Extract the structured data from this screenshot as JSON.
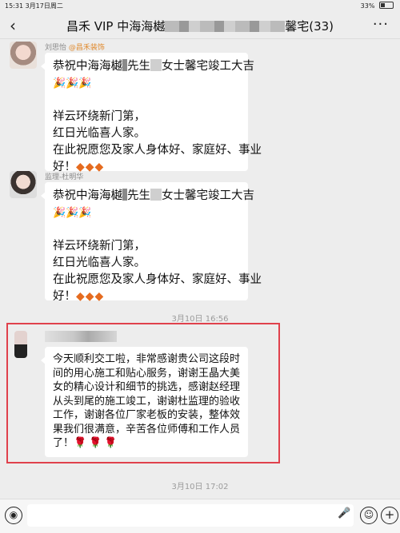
{
  "status": {
    "time_date": "15:31  3月17日周二",
    "battery": "33%",
    "battery_level": 0.33
  },
  "header": {
    "back_icon": "chevron-left-icon",
    "title_prefix": "昌禾 VIP 中海海樾",
    "title_suffix": "馨宅(33)",
    "more_icon": "more-dots-icon"
  },
  "messages": [
    {
      "sender": "刘思怡",
      "tag": "@昌禾装饰",
      "lines": [
        {
          "a": "恭祝中海海樾",
          "b": "先生",
          "c": "女士馨宅竣工大吉"
        },
        {
          "text": "🎉🎉🎉"
        },
        {
          "text": ""
        },
        {
          "text": "祥云环绕新门第，"
        },
        {
          "text": "红日光临喜人家。"
        },
        {
          "text": "在此祝愿您及家人身体好、家庭好、事业"
        },
        {
          "text": "好！",
          "diamonds": "◆◆◆"
        }
      ]
    },
    {
      "sender": "监理-杜明华",
      "lines": [
        {
          "a": "恭祝中海海樾",
          "b": "先生",
          "c": "女士馨宅竣工大吉"
        },
        {
          "text": "🎉🎉🎉"
        },
        {
          "text": ""
        },
        {
          "text": "祥云环绕新门第，"
        },
        {
          "text": "红日光临喜人家。"
        },
        {
          "text": "在此祝愿您及家人身体好、家庭好、事业"
        },
        {
          "text": "好！",
          "diamonds": "◆◆◆"
        }
      ]
    },
    {
      "timestamp": "3月10日 16:56",
      "lines": [
        "今天顺利交工啦，非常感谢贵公司这段时",
        "间的用心施工和贴心服务，谢谢王晶大美",
        "女的精心设计和细节的挑选，感谢赵经理",
        "从头到尾的施工竣工，谢谢杜监理的验收",
        "工作，谢谢各位厂家老板的安装，整体效",
        "果我们很满意，辛苦各位师傅和工作人员",
        "了！"
      ],
      "roses": "🌹🌹🌹"
    }
  ],
  "timestamp2": "3月10日 17:02",
  "input": {
    "value": "",
    "voice_icon": "voice-icon",
    "mic_icon": "mic-icon",
    "emoji_icon": "emoji-icon",
    "add_icon": "plus-icon"
  }
}
